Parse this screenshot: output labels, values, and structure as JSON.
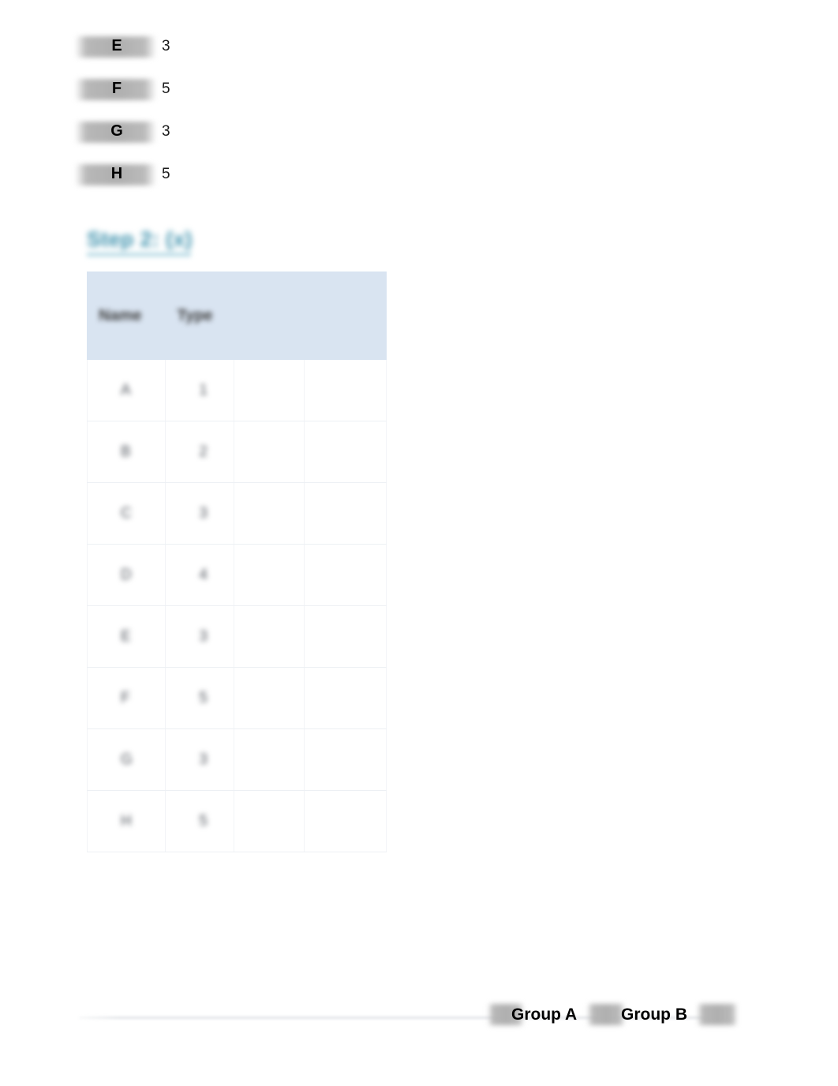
{
  "document": {
    "background_color": "#ffffff",
    "accent_color": "#3e92ad",
    "table_header_color": "#d9e4f1",
    "redaction_color": "#b2b2b2"
  },
  "list": {
    "items": [
      {
        "label": "E",
        "value": "3",
        "redacted_prefix": "",
        "redacted_suffix": ""
      },
      {
        "label": "F",
        "value": "5",
        "redacted_prefix": "",
        "redacted_suffix": ""
      },
      {
        "label": "G",
        "value": "3",
        "redacted_prefix": "",
        "redacted_suffix": ""
      },
      {
        "label": "H",
        "value": "5",
        "redacted_prefix": "",
        "redacted_suffix": ""
      }
    ]
  },
  "section": {
    "heading": "Step 2: (x)"
  },
  "table": {
    "columns": [
      {
        "header": "Name"
      },
      {
        "header": "Type"
      },
      {
        "header": ""
      },
      {
        "header": ""
      }
    ],
    "rows": [
      {
        "name": "A",
        "type": "1",
        "c3": "",
        "c4": ""
      },
      {
        "name": "B",
        "type": "2",
        "c3": "",
        "c4": ""
      },
      {
        "name": "C",
        "type": "3",
        "c3": "",
        "c4": ""
      },
      {
        "name": "D",
        "type": "4",
        "c3": "",
        "c4": ""
      },
      {
        "name": "E",
        "type": "3",
        "c3": "",
        "c4": ""
      },
      {
        "name": "F",
        "type": "5",
        "c3": "",
        "c4": ""
      },
      {
        "name": "G",
        "type": "3",
        "c3": "",
        "c4": ""
      },
      {
        "name": "H",
        "type": "5",
        "c3": "",
        "c4": ""
      }
    ]
  },
  "footer": {
    "group_a_label": "Group A",
    "group_b_label": "Group B"
  }
}
